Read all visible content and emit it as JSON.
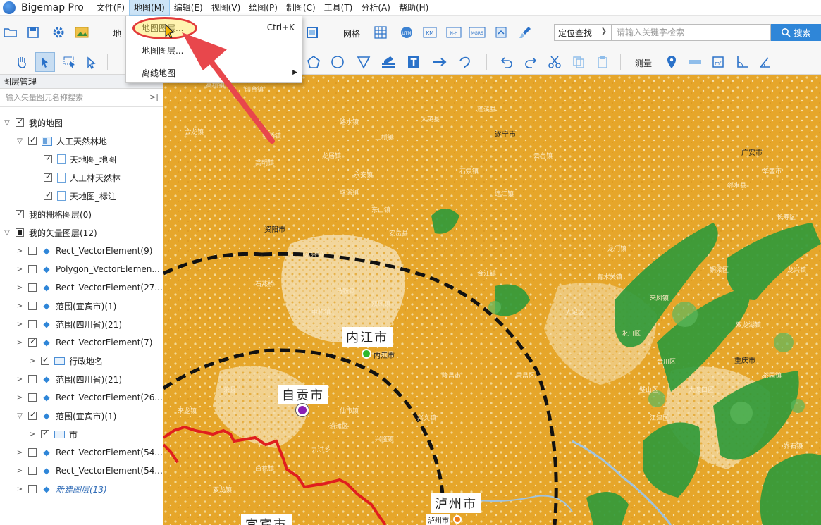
{
  "app": {
    "title": "Bigemap Pro"
  },
  "menubar": {
    "items": [
      {
        "label": "文件(F)"
      },
      {
        "label": "地图(M)"
      },
      {
        "label": "编辑(E)"
      },
      {
        "label": "视图(V)"
      },
      {
        "label": "绘图(P)"
      },
      {
        "label": "制图(C)"
      },
      {
        "label": "工具(T)"
      },
      {
        "label": "分析(A)"
      },
      {
        "label": "帮助(H)"
      }
    ]
  },
  "dropdown": {
    "items": [
      {
        "label": "地图图层...",
        "shortcut": "Ctrl+K"
      },
      {
        "label": "地图图层..."
      },
      {
        "label": "离线地图",
        "submenu_arrow": "▶"
      }
    ]
  },
  "toolbar": {
    "partial_label": "地",
    "grid_label": "网格",
    "locate_label": "定位查找",
    "search_placeholder": "请输入关键字检索",
    "search_button": "搜索",
    "measure_label": "测量"
  },
  "sidebar": {
    "title": "图层管理",
    "search_placeholder": "输入矢量图元名称搜索",
    "tree": [
      {
        "label": "我的地图"
      },
      {
        "label": "人工天然林地"
      },
      {
        "label": "天地图_地图"
      },
      {
        "label": "人工林天然林"
      },
      {
        "label": "天地图_标注"
      },
      {
        "label": "我的栅格图层(0)"
      },
      {
        "label": "我的矢量图层(12)"
      },
      {
        "label": "Rect_VectorElement(9)"
      },
      {
        "label": "Polygon_VectorElemen..."
      },
      {
        "label": "Rect_VectorElement(27..."
      },
      {
        "label": "范围(宜宾市)(1)"
      },
      {
        "label": "范围(四川省)(21)"
      },
      {
        "label": "Rect_VectorElement(7)"
      },
      {
        "label": "行政地名"
      },
      {
        "label": "范围(四川省)(21)"
      },
      {
        "label": "Rect_VectorElement(26..."
      },
      {
        "label": "范围(宜宾市)(1)"
      },
      {
        "label": "市"
      },
      {
        "label": "Rect_VectorElement(54..."
      },
      {
        "label": "Rect_VectorElement(54..."
      },
      {
        "label": "新建图层(13)"
      }
    ]
  },
  "map": {
    "cities": {
      "neijiang": {
        "box": "内江市",
        "label": "内江市"
      },
      "zigong": {
        "box": "自贡市"
      },
      "luzhou": {
        "box": "泸州市",
        "label": "泸州市"
      },
      "yibin": {
        "box": "宜宾市"
      },
      "suining": {
        "label": "遂宁市"
      },
      "ziyang": {
        "label": "资阳市"
      },
      "chongqing": {
        "label": "重庆市"
      },
      "guangan": {
        "label": "广安市"
      }
    },
    "towns": [
      "高桥镇",
      "印台镇",
      "大英县",
      "香桥镇",
      "路水镇",
      "三桥镇",
      "蓬溪县",
      "会龙镇",
      "云台镇",
      "高明镇",
      "龙居镇",
      "石泉镇",
      "永安镇",
      "东山镇",
      "安岳县",
      "珠溪镇",
      "连江镇",
      "东兴镇",
      "马鞍镇",
      "石燕桥",
      "双凤镇",
      "中和镇",
      "合江镇",
      "龙门镇",
      "来凤镇",
      "永川区",
      "铜梁区",
      "大足区",
      "荣昌区",
      "隆昌市",
      "富顺县",
      "仙市镇",
      "沿滩区",
      "九洪乡",
      "兴隆镇",
      "兴文镇",
      "荣县",
      "来龙镇",
      "白花镇",
      "双龙镇",
      "华蓥市",
      "邻水县",
      "合川区",
      "璧山区",
      "江津区",
      "双龙湖镇",
      "茶园镇",
      "界石镇",
      "长寿区",
      "龙兴镇",
      "青木关镇",
      "大渡口区"
    ],
    "legend_colors": {
      "forest": "#2e9a3a",
      "base": "#e6a62a",
      "boundary": "#e01e1e",
      "ring": "#111111"
    }
  },
  "colors": {
    "accent": "#2f86d8",
    "highlight": "#cce4f7",
    "arrow": "#e8474c"
  }
}
